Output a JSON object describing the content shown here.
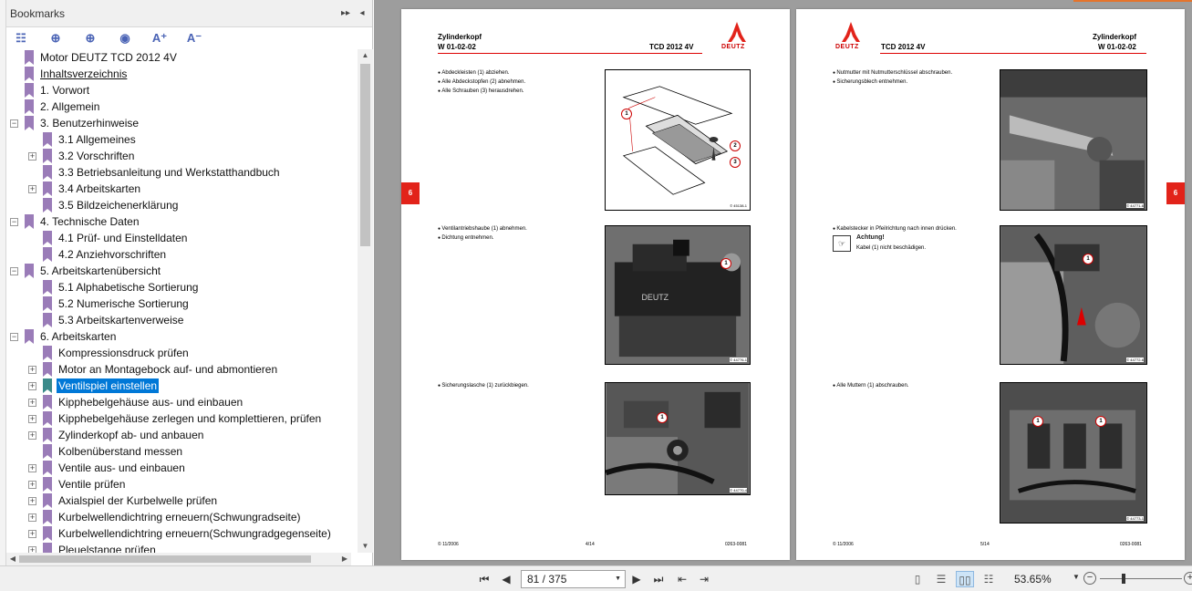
{
  "bookmarks": {
    "title": "Bookmarks",
    "items": [
      {
        "label": "Motor DEUTZ TCD 2012 4V",
        "level": 0,
        "toggle": "",
        "style": ""
      },
      {
        "label": "Inhaltsverzeichnis",
        "level": 0,
        "toggle": "",
        "style": "under"
      },
      {
        "label": "1. Vorwort",
        "level": 0,
        "toggle": "",
        "style": ""
      },
      {
        "label": "2. Allgemein",
        "level": 0,
        "toggle": "",
        "style": ""
      },
      {
        "label": "3. Benutzerhinweise",
        "level": 0,
        "toggle": "−",
        "style": ""
      },
      {
        "label": "3.1 Allgemeines",
        "level": 1,
        "toggle": "",
        "style": ""
      },
      {
        "label": "3.2 Vorschriften",
        "level": 1,
        "toggle": "+",
        "style": ""
      },
      {
        "label": "3.3 Betriebsanleitung und Werkstatthandbuch",
        "level": 1,
        "toggle": "",
        "style": ""
      },
      {
        "label": "3.4 Arbeitskarten",
        "level": 1,
        "toggle": "+",
        "style": ""
      },
      {
        "label": "3.5 Bildzeichenerklärung",
        "level": 1,
        "toggle": "",
        "style": ""
      },
      {
        "label": "4. Technische Daten",
        "level": 0,
        "toggle": "−",
        "style": ""
      },
      {
        "label": "4.1 Prüf- und Einstelldaten",
        "level": 1,
        "toggle": "",
        "style": ""
      },
      {
        "label": "4.2 Anziehvorschriften",
        "level": 1,
        "toggle": "",
        "style": ""
      },
      {
        "label": "5. Arbeitskartenübersicht",
        "level": 0,
        "toggle": "−",
        "style": ""
      },
      {
        "label": "5.1 Alphabetische Sortierung",
        "level": 1,
        "toggle": "",
        "style": ""
      },
      {
        "label": "5.2 Numerische Sortierung",
        "level": 1,
        "toggle": "",
        "style": ""
      },
      {
        "label": "5.3 Arbeitskartenverweise",
        "level": 1,
        "toggle": "",
        "style": ""
      },
      {
        "label": "6. Arbeitskarten",
        "level": 0,
        "toggle": "−",
        "style": ""
      },
      {
        "label": "Kompressionsdruck prüfen",
        "level": 1,
        "toggle": "",
        "style": ""
      },
      {
        "label": "Motor an Montagebock auf- und abmontieren",
        "level": 1,
        "toggle": "+",
        "style": ""
      },
      {
        "label": "Ventilspiel einstellen",
        "level": 1,
        "toggle": "+",
        "style": "selected"
      },
      {
        "label": "Kipphebelgehäuse aus- und einbauen",
        "level": 1,
        "toggle": "+",
        "style": ""
      },
      {
        "label": "Kipphebelgehäuse zerlegen und komplettieren, prüfen",
        "level": 1,
        "toggle": "+",
        "style": ""
      },
      {
        "label": "Zylinderkopf ab- und anbauen",
        "level": 1,
        "toggle": "+",
        "style": ""
      },
      {
        "label": "Kolbenüberstand messen",
        "level": 1,
        "toggle": "",
        "style": ""
      },
      {
        "label": "Ventile aus- und einbauen",
        "level": 1,
        "toggle": "+",
        "style": ""
      },
      {
        "label": "Ventile prüfen",
        "level": 1,
        "toggle": "+",
        "style": ""
      },
      {
        "label": "Axialspiel der Kurbelwelle prüfen",
        "level": 1,
        "toggle": "+",
        "style": ""
      },
      {
        "label": "Kurbelwellendichtring erneuern(Schwungradseite)",
        "level": 1,
        "toggle": "+",
        "style": ""
      },
      {
        "label": "Kurbelwellendichtring erneuern(Schwungradgegenseite)",
        "level": 1,
        "toggle": "+",
        "style": ""
      },
      {
        "label": "Pleuelstange prüfen",
        "level": 1,
        "toggle": "+",
        "style": ""
      }
    ]
  },
  "pages": {
    "left": {
      "title1": "Zylinderkopf",
      "title2": "W 01-02-02",
      "engine": "TCD 2012 4V",
      "tab": "6",
      "brand": "DEUTZ",
      "step1": [
        "Abdeckleisten (1) abziehen.",
        "Alle Abdeckstopfen (2) abnehmen.",
        "Alle Schrauben (3) herausdrehen."
      ],
      "step2": [
        "Ventilantriebshaube (1) abnehmen.",
        "Dichtung entnehmen."
      ],
      "step3": [
        "Sicherungslasche (1) zurückbiegen."
      ],
      "fig1_id": "© 45138-1",
      "fig2_id": "© 44776-1",
      "fig3_id": "© 44770-4",
      "footer_left": "© 11/2006",
      "footer_mid": "4/14",
      "footer_right": "0263-0081"
    },
    "right": {
      "title1": "Zylinderkopf",
      "title2": "W 01-02-02",
      "engine": "TCD 2012 4V",
      "tab": "6",
      "brand": "DEUTZ",
      "step1": [
        "Nutmutter mit Nutmutterschlüssel abschrauben.",
        "Sicherungsblech entnehmen."
      ],
      "step2": [
        "Kabelstecker in Pfeilrichtung nach innen drücken."
      ],
      "achtung_title": "Achtung!",
      "achtung_text": "Kabel (1) nicht beschädigen.",
      "step3": [
        "Alle Muttern (1) abschrauben."
      ],
      "fig1_id": "© 44771-6",
      "fig2_id": "© 44772-6",
      "fig3_id": "© 44773-1",
      "footer_left": "© 11/2006",
      "footer_mid": "5/14",
      "footer_right": "0263-0081"
    }
  },
  "toolbar": {
    "page_value": "81 / 375",
    "zoom": "53.65%"
  },
  "colors": {
    "accent": "#0078d7",
    "bookmark": "#9a7cb8",
    "deutz_red": "#e2231a"
  }
}
